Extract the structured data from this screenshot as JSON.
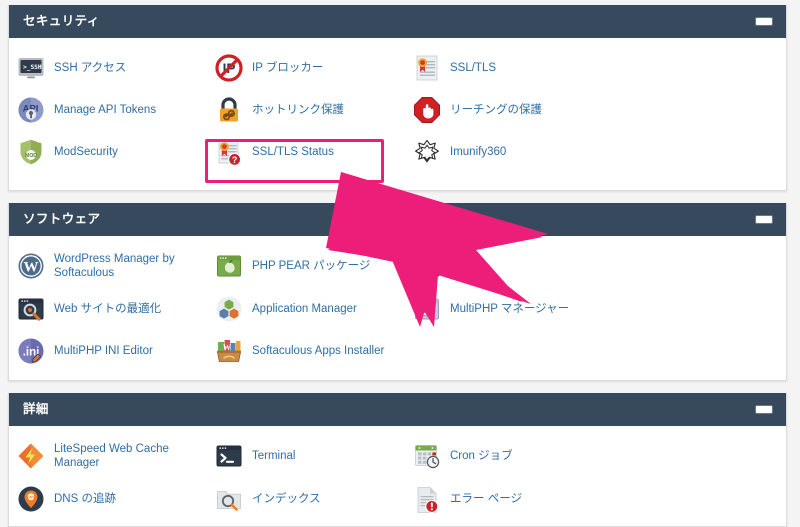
{
  "page": {
    "background": "#f4f4f4",
    "link_color": "#2f6ea5",
    "header_bg": "#36495d",
    "highlight_color": "#ec1e79"
  },
  "annotations": {
    "highlight": {
      "target_label": "SSL/TLS Status",
      "color": "#ec1e79"
    },
    "arrow": {
      "color": "#ec1e79",
      "points_to": "SSL/TLS Status"
    }
  },
  "panels": [
    {
      "id": "security",
      "title": "セキュリティ",
      "minimize_label": "−",
      "items": [
        {
          "label": "SSH アクセス",
          "icon": "ssh-terminal-icon"
        },
        {
          "label": "IP ブロッカー",
          "icon": "ip-blocker-icon"
        },
        {
          "label": "SSL/TLS",
          "icon": "ssl-certificate-icon"
        },
        {
          "label": "Manage API Tokens",
          "icon": "api-token-icon"
        },
        {
          "label": "ホットリンク保護",
          "icon": "hotlink-lock-icon"
        },
        {
          "label": "リーチングの保護",
          "icon": "leech-protection-icon"
        },
        {
          "label": "ModSecurity",
          "icon": "modsecurity-shield-icon"
        },
        {
          "label": "SSL/TLS Status",
          "icon": "ssl-status-icon",
          "highlighted": true
        },
        {
          "label": "Imunify360",
          "icon": "imunify360-icon"
        }
      ]
    },
    {
      "id": "software",
      "title": "ソフトウェア",
      "minimize_label": "−",
      "items": [
        {
          "label": "WordPress Manager by Softaculous",
          "icon": "wordpress-icon"
        },
        {
          "label": "PHP PEAR パッケージ",
          "icon": "php-pear-icon"
        },
        {
          "label": "",
          "icon": "apache-handlers-icon",
          "obscured": true
        },
        {
          "label": "Web サイトの最適化",
          "icon": "optimize-website-icon"
        },
        {
          "label": "Application Manager",
          "icon": "application-manager-icon"
        },
        {
          "label": "MultiPHP マネージャー",
          "icon": "multiphp-manager-icon"
        },
        {
          "label": "MultiPHP INI Editor",
          "icon": "multiphp-ini-icon"
        },
        {
          "label": "Softaculous Apps Installer",
          "icon": "softaculous-icon"
        }
      ]
    },
    {
      "id": "advanced",
      "title": "詳細",
      "minimize_label": "−",
      "items": [
        {
          "label": "LiteSpeed Web Cache Manager",
          "icon": "litespeed-icon"
        },
        {
          "label": "Terminal",
          "icon": "terminal-icon"
        },
        {
          "label": "Cron ジョブ",
          "icon": "cron-calendar-icon"
        },
        {
          "label": "DNS の追跡",
          "icon": "dns-track-icon"
        },
        {
          "label": "インデックス",
          "icon": "indexes-icon"
        },
        {
          "label": "エラー ページ",
          "icon": "error-pages-icon"
        }
      ]
    }
  ]
}
